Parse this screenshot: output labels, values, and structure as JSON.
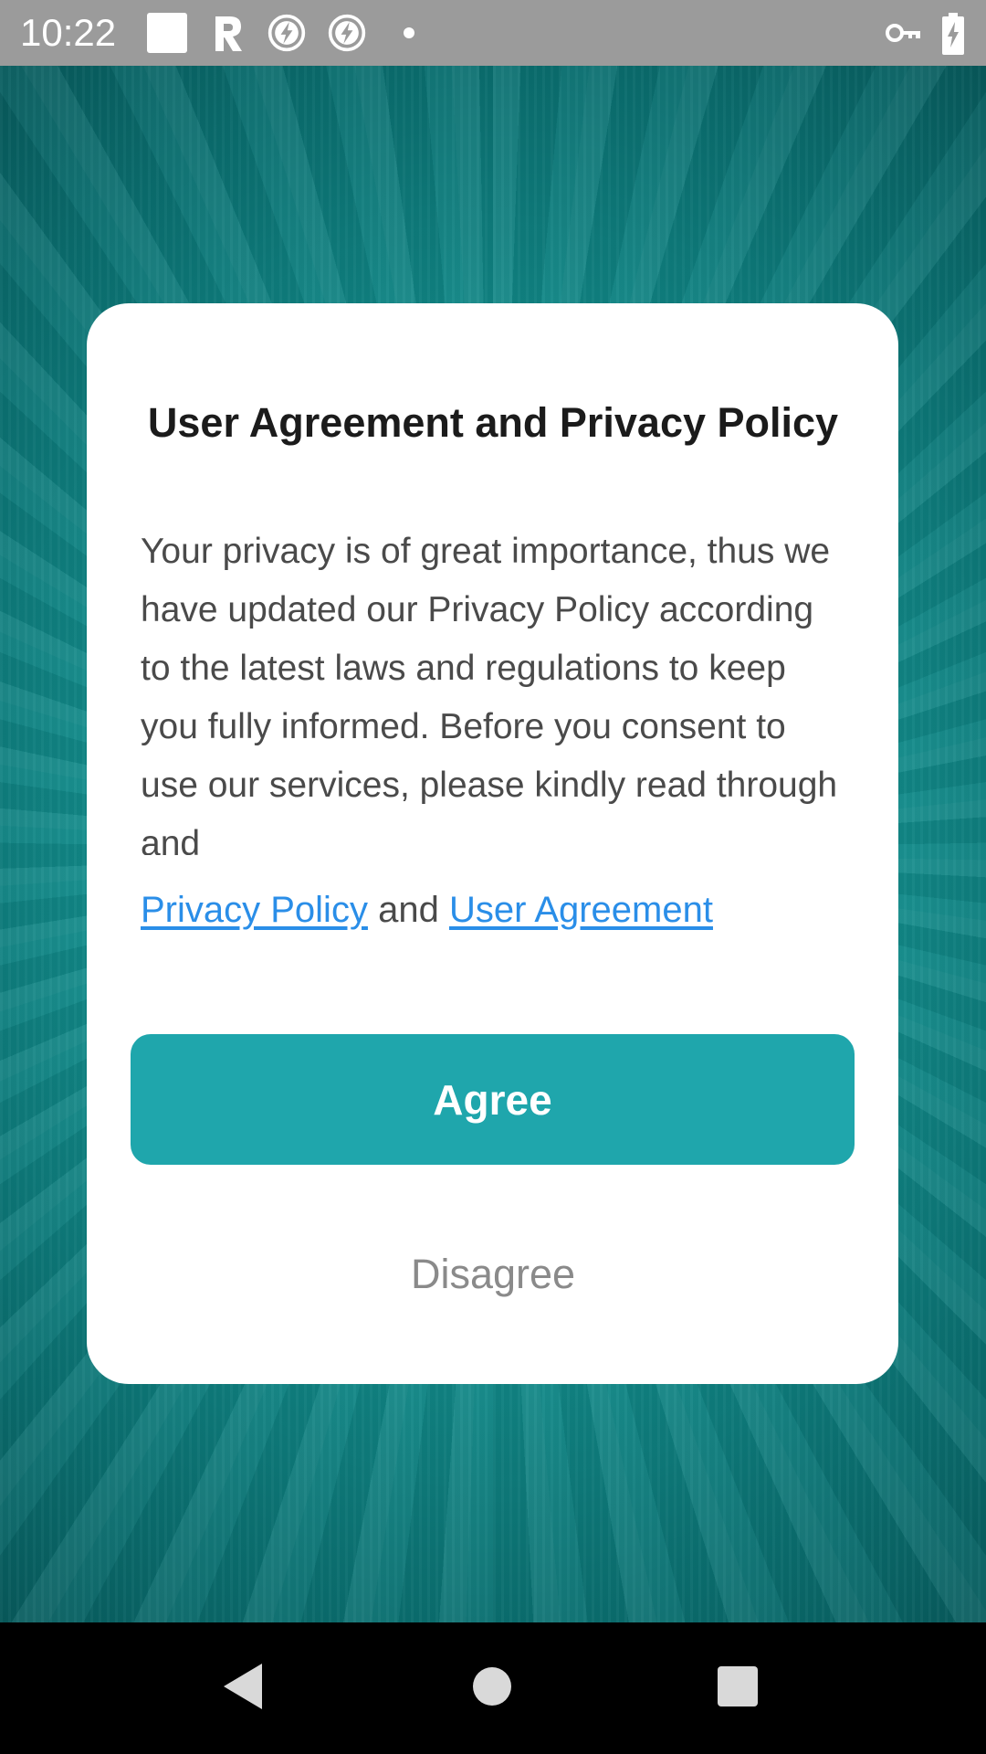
{
  "status_bar": {
    "time": "10:22",
    "icons": [
      "square-icon",
      "r-app-icon",
      "flash-icon",
      "flash-icon",
      "dot-icon",
      "vpn-key-icon",
      "battery-charging-icon"
    ]
  },
  "dialog": {
    "title": "User Agreement and Privacy Policy",
    "body": "Your privacy is of great importance, thus we have updated our Privacy Policy according to the latest laws and regulations to keep you fully informed. Before you consent to use our services, please kindly read through and",
    "privacy_policy_link": "Privacy Policy",
    "and_text": "and",
    "user_agreement_link": "User Agreement",
    "agree_label": "Agree",
    "disagree_label": "Disagree"
  },
  "nav_bar": {
    "icons": [
      "back-icon",
      "home-icon",
      "recents-icon"
    ]
  },
  "colors": {
    "accent": "#1fa6ac",
    "link": "#2a8ee8",
    "status_bar": "#9b9b9b",
    "wallpaper": "#13908f"
  }
}
